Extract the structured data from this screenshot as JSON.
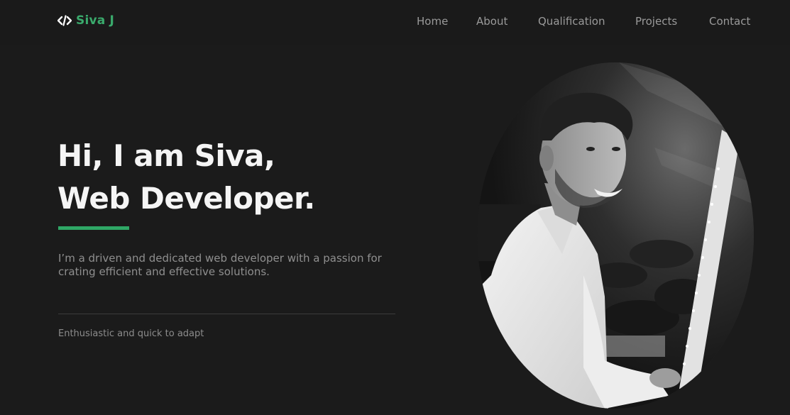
{
  "brand": {
    "icon": "code-icon",
    "name": "Siva J",
    "accent_color": "#3aaa6c"
  },
  "nav": {
    "items": [
      {
        "label": "Home"
      },
      {
        "label": "About"
      },
      {
        "label": "Qualification"
      },
      {
        "label": "Projects"
      },
      {
        "label": "Contact"
      }
    ]
  },
  "hero": {
    "title_line1": "Hi, I am Siva,",
    "title_line2": "Web Developer.",
    "description": "I’m a driven and dedicated web developer with a passion for crating efficient and effective solutions.",
    "tagline": "Enthusiastic and quick to adapt"
  },
  "portrait": {
    "style": "grayscale"
  },
  "colors": {
    "background": "#1b1b1b",
    "accent": "#2fa866",
    "title": "#f5f5f5",
    "muted_text": "#8f8f8f"
  }
}
